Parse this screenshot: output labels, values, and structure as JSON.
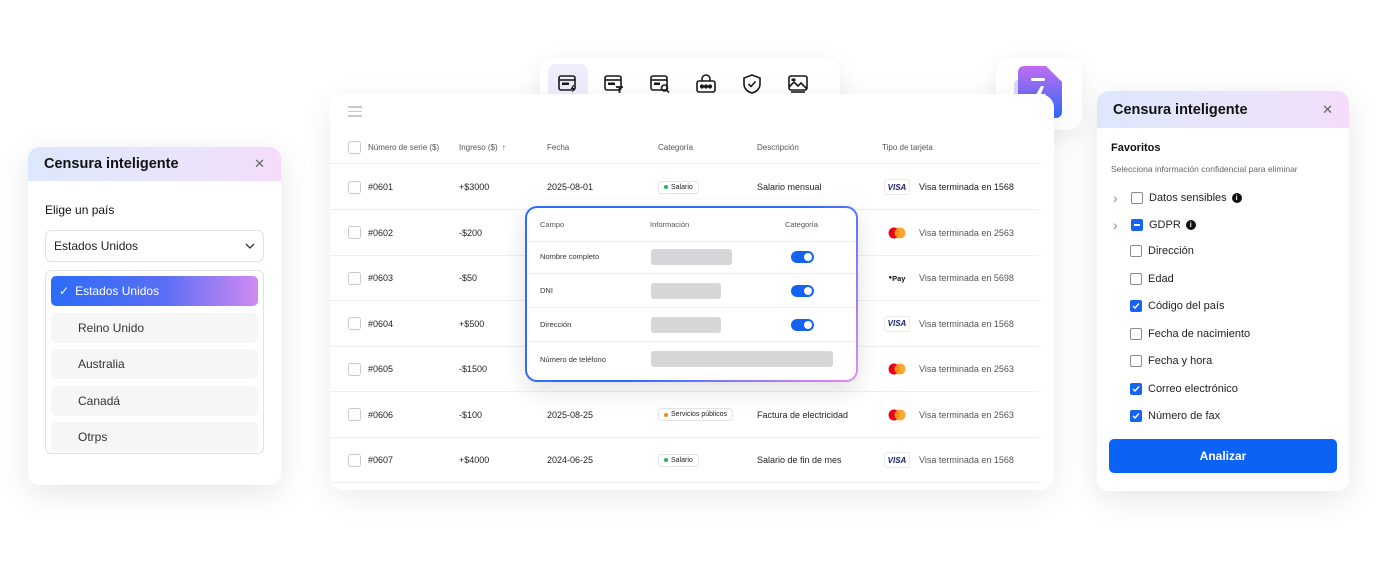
{
  "toolbar": {
    "icons": [
      "smart-redact-icon",
      "redact-text-icon",
      "search-redact-icon",
      "password-icon",
      "shield-icon",
      "image-redact-icon"
    ]
  },
  "colors": {
    "accent": "#0a63f5",
    "gradient_start": "#2c6cf6",
    "gradient_end": "#d18af2",
    "toggle_on": "#1463f3"
  },
  "table": {
    "headers": {
      "serial": "Número de serie ($)",
      "income": "Ingreso ($)",
      "date": "Fecha",
      "category": "Categoría",
      "description": "Descripción",
      "card_type": "Tipo de tarjeta"
    },
    "rows": [
      {
        "serial": "#0601",
        "income": "+$3000",
        "date": "2025-08-01",
        "category": "Salario",
        "category_color": "#2eae5a",
        "description": "Salario mensual",
        "card": "visa",
        "card_label": "VISA",
        "card_text": "Visa terminada en 1568"
      },
      {
        "serial": "#0602",
        "income": "-$200",
        "date": "",
        "category": "",
        "category_color": "",
        "description": "",
        "card": "mastercard",
        "card_label": "",
        "card_text": "Visa terminada en 2563"
      },
      {
        "serial": "#0603",
        "income": "-$50",
        "date": "",
        "category": "",
        "category_color": "",
        "description": "",
        "card": "applepay",
        "card_label": "Pay",
        "card_text": "Visa terminada en 5698"
      },
      {
        "serial": "#0604",
        "income": "+$500",
        "date": "",
        "category": "",
        "category_color": "",
        "description": "",
        "card": "visa",
        "card_label": "VISA",
        "card_text": "Visa terminada en 1568"
      },
      {
        "serial": "#0605",
        "income": "-$1500",
        "date": "",
        "category": "",
        "category_color": "",
        "description": "",
        "card": "mastercard",
        "card_label": "",
        "card_text": "Visa terminada en 2563"
      },
      {
        "serial": "#0606",
        "income": "-$100",
        "date": "2025-08-25",
        "category": "Servicios públicos",
        "category_color": "#f08a1c",
        "description": "Factura de electricidad",
        "card": "mastercard",
        "card_label": "",
        "card_text": "Visa terminada en 2563"
      },
      {
        "serial": "#0607",
        "income": "+$4000",
        "date": "2024-06-25",
        "category": "Salario",
        "category_color": "#2eae5a",
        "description": "Salario de fin de mes",
        "card": "visa",
        "card_label": "VISA",
        "card_text": "Visa terminada en 1568"
      }
    ]
  },
  "field_popup": {
    "headers": {
      "field": "Campo",
      "info": "Información",
      "category": "Categoría"
    },
    "rows": [
      {
        "field": "Nombre completo",
        "toggle": true
      },
      {
        "field": "DNI",
        "toggle": true
      },
      {
        "field": "Dirección",
        "toggle": true
      },
      {
        "field": "Número de teléfono",
        "toggle": false
      }
    ]
  },
  "left_panel": {
    "title": "Censura inteligente",
    "label": "Elige un país",
    "selected": "Estados Unidos",
    "options": [
      "Estados Unidos",
      "Reino Unido",
      "Australia",
      "Canadá",
      "Otrps"
    ]
  },
  "right_panel": {
    "title": "Censura inteligente",
    "favorites": "Favoritos",
    "subtitle": "Selecciona información confidencial para eliminar",
    "groups": [
      {
        "label": "Datos sensibles",
        "state": "unchecked"
      },
      {
        "label": "GDPR",
        "state": "partial"
      }
    ],
    "items": [
      {
        "label": "Dirección",
        "checked": false
      },
      {
        "label": "Edad",
        "checked": false
      },
      {
        "label": "Código del país",
        "checked": true
      },
      {
        "label": "Fecha de nacimiento",
        "checked": false
      },
      {
        "label": "Fecha y hora",
        "checked": false
      },
      {
        "label": "Correo electrónico",
        "checked": true
      },
      {
        "label": "Número de fax",
        "checked": true
      }
    ],
    "button": "Analizar"
  }
}
